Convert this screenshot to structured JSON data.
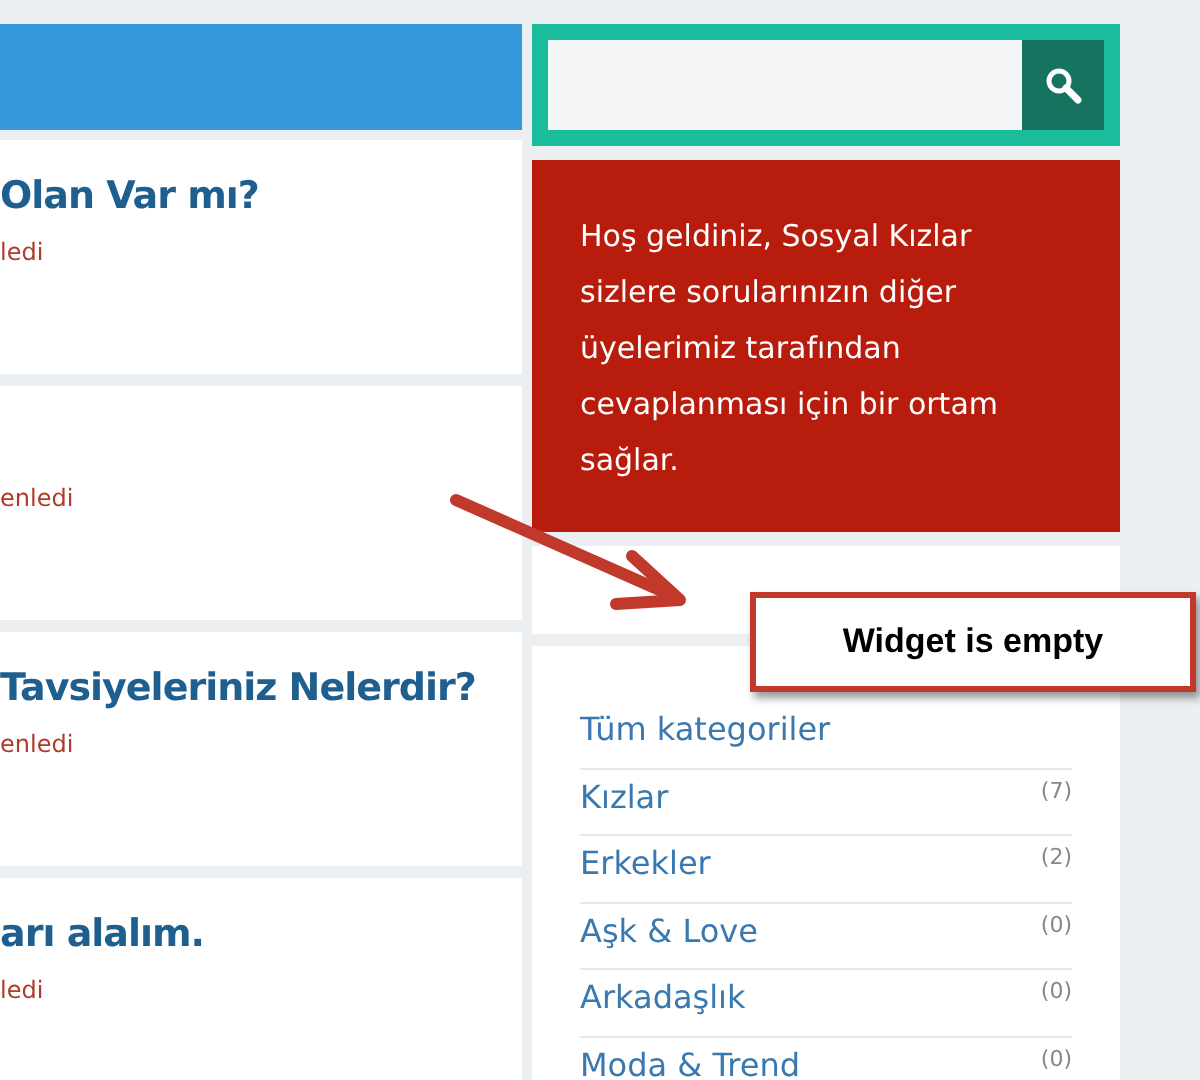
{
  "posts": [
    {
      "title": "Olan Var mı?",
      "meta": "ledi"
    },
    {
      "meta": "enledi"
    },
    {
      "title": "Tavsiyeleriniz Nelerdir?",
      "meta": "enledi"
    },
    {
      "title": "arı alalım.",
      "meta": "ledi"
    }
  ],
  "welcome": {
    "text": "Hoş geldiniz, Sosyal Kızlar sizlere sorularınızın diğer üyelerimiz tarafından cevaplanması için bir ortam sağlar."
  },
  "categories": [
    {
      "name": "Tüm kategoriler"
    },
    {
      "name": "Kızlar",
      "count": "(7)"
    },
    {
      "name": "Erkekler",
      "count": "(2)"
    },
    {
      "name": "Aşk & Love",
      "count": "(0)"
    },
    {
      "name": "Arkadaşlık",
      "count": "(0)"
    },
    {
      "name": "Moda & Trend",
      "count": "(0)"
    }
  ],
  "annotation": {
    "text": "Widget is empty"
  }
}
